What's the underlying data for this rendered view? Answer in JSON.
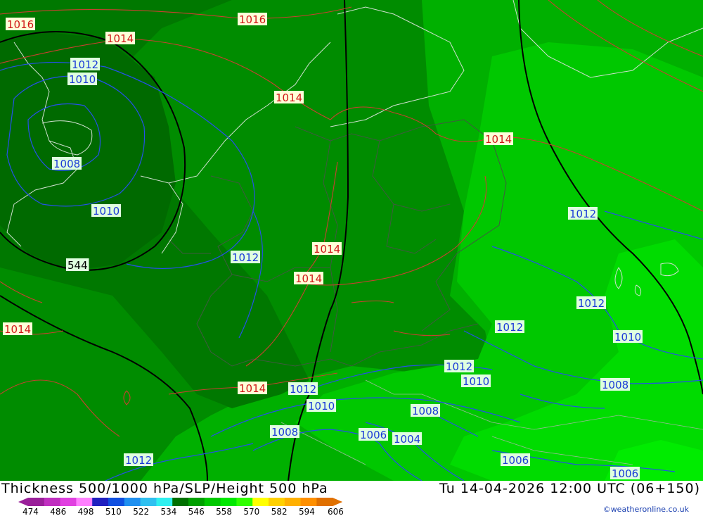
{
  "map": {
    "palette": {
      "bg_main": "#00a800",
      "bg_dark": "#008a00",
      "bg_darker": "#006e00",
      "bg_light": "#00c800",
      "bg_lighter": "#00e000",
      "isobar_blue": "#2040e0",
      "thickness_red": "#d04030",
      "height_black": "#000000",
      "border_color": "#405040"
    },
    "isobar_labels": [
      {
        "text": "1016",
        "kind": "red"
      },
      {
        "text": "1016",
        "kind": "red"
      },
      {
        "text": "1014",
        "kind": "red"
      },
      {
        "text": "1012",
        "kind": "blue"
      },
      {
        "text": "1010",
        "kind": "blue"
      },
      {
        "text": "1014",
        "kind": "red"
      },
      {
        "text": "1008",
        "kind": "blue"
      },
      {
        "text": "1014",
        "kind": "red"
      },
      {
        "text": "1010",
        "kind": "blue"
      },
      {
        "text": "1012",
        "kind": "blue"
      },
      {
        "text": "1014",
        "kind": "red"
      },
      {
        "text": "1012",
        "kind": "blue"
      },
      {
        "text": "544",
        "kind": "black"
      },
      {
        "text": "1014",
        "kind": "red"
      },
      {
        "text": "1014",
        "kind": "red"
      },
      {
        "text": "1012",
        "kind": "blue"
      },
      {
        "text": "1012",
        "kind": "blue"
      },
      {
        "text": "1010",
        "kind": "blue"
      },
      {
        "text": "1012",
        "kind": "blue"
      },
      {
        "text": "1010",
        "kind": "blue"
      },
      {
        "text": "1014",
        "kind": "red"
      },
      {
        "text": "1012",
        "kind": "blue"
      },
      {
        "text": "1008",
        "kind": "blue"
      },
      {
        "text": "1010",
        "kind": "blue"
      },
      {
        "text": "1008",
        "kind": "blue"
      },
      {
        "text": "1008",
        "kind": "blue"
      },
      {
        "text": "1006",
        "kind": "blue"
      },
      {
        "text": "1004",
        "kind": "blue"
      },
      {
        "text": "1012",
        "kind": "blue"
      },
      {
        "text": "1006",
        "kind": "blue"
      },
      {
        "text": "1006",
        "kind": "blue"
      }
    ]
  },
  "footer": {
    "title_left": "Thickness 500/1000 hPa/SLP/Height 500 hPa",
    "title_right": "Tu 14-04-2026 12:00 UTC (06+150)",
    "credit": "©weatheronline.co.uk"
  },
  "scale": {
    "ticks": [
      "474",
      "486",
      "498",
      "510",
      "522",
      "534",
      "546",
      "558",
      "570",
      "582",
      "594",
      "606"
    ],
    "colors": [
      "#9a209a",
      "#c030c0",
      "#e040e0",
      "#ff80ff",
      "#2020c0",
      "#1050e0",
      "#2090f0",
      "#30c0f0",
      "#30f0f0",
      "#007000",
      "#00a000",
      "#00c800",
      "#00e800",
      "#30ff00",
      "#ffff00",
      "#ffd000",
      "#ffb000",
      "#ff9000",
      "#e07000"
    ]
  }
}
